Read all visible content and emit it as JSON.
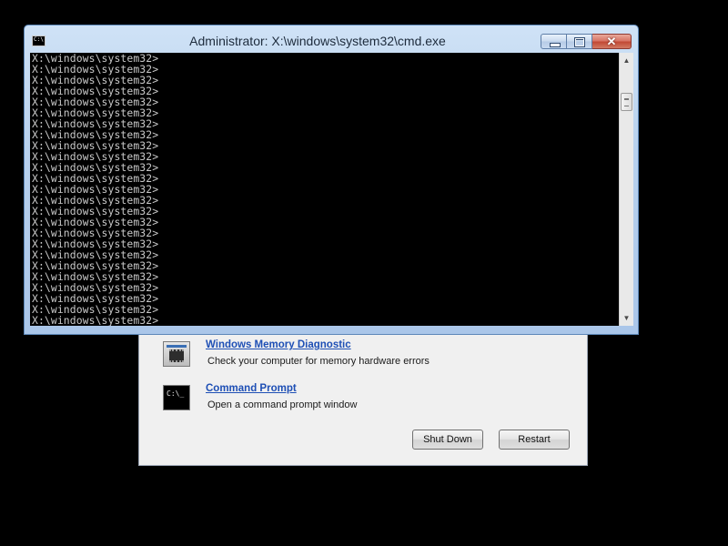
{
  "recovery": {
    "items": [
      {
        "title": "Windows Memory Diagnostic",
        "description": "Check your computer for memory hardware errors",
        "icon": "memory-chip-icon"
      },
      {
        "title": "Command Prompt",
        "description": "Open a command prompt window",
        "icon": "command-prompt-icon"
      }
    ],
    "cmd_icon_text": "C:\\_",
    "shutdown_label": "Shut Down",
    "restart_label": "Restart"
  },
  "cmd": {
    "title": "Administrator: X:\\windows\\system32\\cmd.exe",
    "icon_text": "C:\\",
    "close_glyph": "✕",
    "lines": [
      "X:\\windows\\system32>",
      "X:\\windows\\system32>",
      "X:\\windows\\system32>",
      "X:\\windows\\system32>",
      "X:\\windows\\system32>",
      "X:\\windows\\system32>",
      "X:\\windows\\system32>",
      "X:\\windows\\system32>",
      "X:\\windows\\system32>",
      "X:\\windows\\system32>",
      "X:\\windows\\system32>",
      "X:\\windows\\system32>",
      "X:\\windows\\system32>",
      "X:\\windows\\system32>",
      "X:\\windows\\system32>",
      "X:\\windows\\system32>",
      "X:\\windows\\system32>",
      "X:\\windows\\system32>",
      "X:\\windows\\system32>",
      "X:\\windows\\system32>",
      "X:\\windows\\system32>",
      "X:\\windows\\system32>",
      "X:\\windows\\system32>",
      "X:\\windows\\system32>",
      "X:\\windows\\system32>"
    ],
    "scroll_up_glyph": "▲",
    "scroll_down_glyph": "▼"
  },
  "colors": {
    "desktop": "#000000",
    "console_bg": "#000000",
    "console_text": "#c9c9c9",
    "link": "#1e4fb5",
    "dialog_bg": "#f0f0f0",
    "window_frame": "#b8d1ee"
  }
}
